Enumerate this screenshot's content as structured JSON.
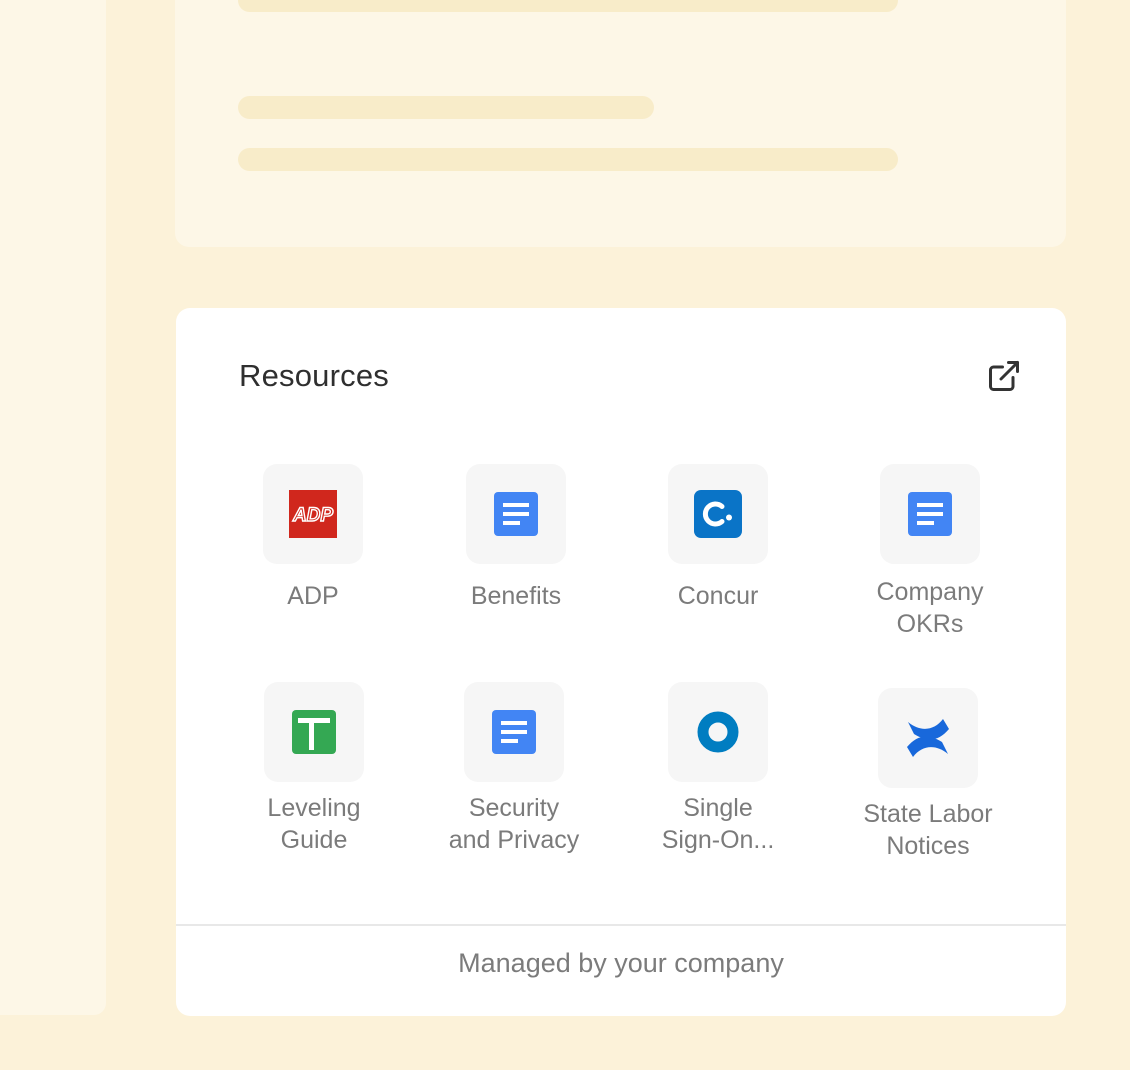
{
  "resources": {
    "title": "Resources",
    "items": [
      {
        "label": "ADP",
        "icon": "adp-logo-icon"
      },
      {
        "label": "Benefits",
        "icon": "google-docs-icon"
      },
      {
        "label": "Concur",
        "icon": "concur-logo-icon"
      },
      {
        "label": "Company\nOKRs",
        "icon": "google-docs-icon"
      },
      {
        "label": "Leveling\nGuide",
        "icon": "google-sheets-icon"
      },
      {
        "label": "Security\nand Privacy",
        "icon": "google-docs-icon"
      },
      {
        "label": "Single\nSign-On...",
        "icon": "okta-logo-icon"
      },
      {
        "label": "State Labor\nNotices",
        "icon": "confluence-logo-icon"
      }
    ],
    "footer": "Managed by your company"
  },
  "colors": {
    "page_background": "#fcf2d9",
    "skeleton": "#f8ecc9",
    "adp_red": "#d0271d",
    "docs_blue": "#4285f4",
    "sheets_green": "#34a853",
    "concur_blue": "#0a74c7",
    "okta_blue": "#007dc1",
    "confluence_blue": "#1868db"
  }
}
